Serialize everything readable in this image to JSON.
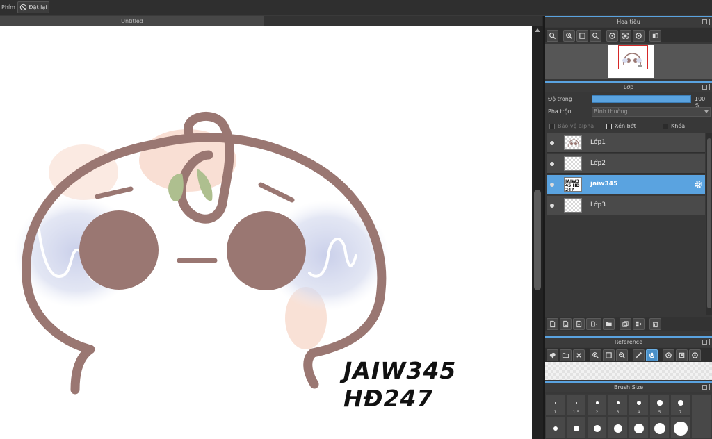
{
  "topbar": {
    "label": "Phím",
    "reset_label": "Đặt lại"
  },
  "document": {
    "tab_title": "Untitled"
  },
  "canvas": {
    "text_line1": "JAIW345",
    "text_line2": "HĐ247"
  },
  "navigator": {
    "title": "Hoa tiêu"
  },
  "layers": {
    "title": "Lớp",
    "opacity_label": "Độ trong",
    "opacity_value": "100 %",
    "opacity_fill": 1.0,
    "blend_label": "Pha trộn",
    "blend_value": "Bình thường",
    "protect_alpha": "Bảo vệ alpha",
    "clipping": "Xén bớt",
    "lock": "Khóa",
    "items": [
      {
        "name": "Lớp1"
      },
      {
        "name": "Lớp2"
      },
      {
        "name": "jaiw345",
        "thumb_text": "JAIW345 HĐ247",
        "selected": true
      },
      {
        "name": "Lớp3"
      }
    ]
  },
  "reference": {
    "title": "Reference"
  },
  "brush_size": {
    "title": "Brush Size",
    "row1": [
      "1",
      "1.5",
      "2",
      "3",
      "4",
      "5",
      "7"
    ],
    "row2": [
      "",
      "",
      "",
      "",
      "",
      "",
      ""
    ]
  },
  "colors": {
    "accent": "#5aa3e0",
    "panel": "#383838",
    "outline": "#9a7772"
  }
}
